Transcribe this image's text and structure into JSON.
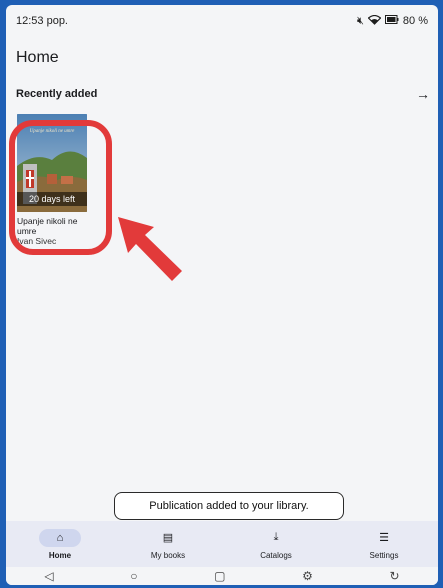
{
  "status_bar": {
    "time": "12:53 pop.",
    "mute_icon": "speaker-muted-icon",
    "wifi_icon": "wifi-icon",
    "battery_icon": "battery-icon",
    "battery_text": "80 %"
  },
  "app": {
    "title": "Home"
  },
  "recently_added": {
    "title": "Recently added",
    "arrow_icon": "arrow-right-icon",
    "books": [
      {
        "cover_heading": "Upanje nikoli ne umre",
        "badge": "20 days left",
        "title": "Upanje nikoli ne umre",
        "author": "Ivan Sivec"
      }
    ]
  },
  "toast": {
    "message": "Publication added to your library."
  },
  "bottom_nav": {
    "items": [
      {
        "label": "Home",
        "icon": "home-icon",
        "glyph": "⌂",
        "active": true
      },
      {
        "label": "My books",
        "icon": "books-icon",
        "glyph": "▤",
        "active": false
      },
      {
        "label": "Catalogs",
        "icon": "download-icon",
        "glyph": "⤓",
        "active": false
      },
      {
        "label": "Settings",
        "icon": "menu-icon",
        "glyph": "☰",
        "active": false
      }
    ]
  },
  "system_nav": {
    "back": "◁",
    "home": "○",
    "recents": "▢",
    "extra": "⚙",
    "rotate": "↻"
  },
  "colors": {
    "accent": "#cfd6ee",
    "highlight": "#e23a3a",
    "nav_bg": "#e8eaf4"
  }
}
